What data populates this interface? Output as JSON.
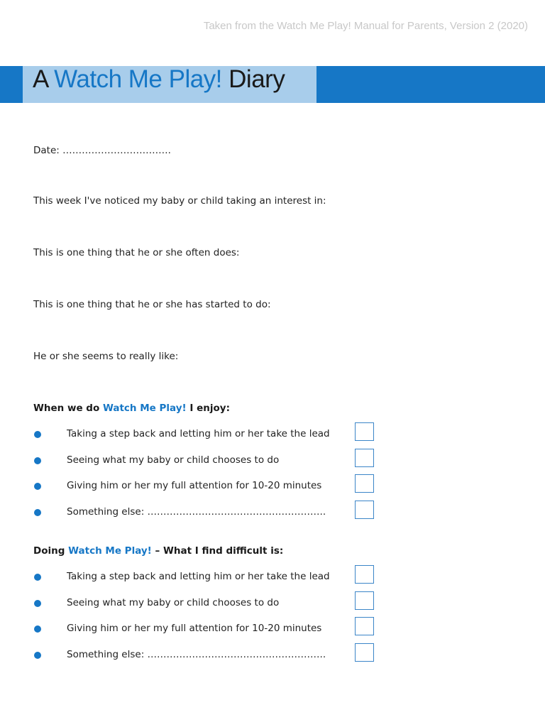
{
  "source_note": "Taken from the Watch Me Play! Manual for Parents, Version 2 (2020)",
  "title": {
    "prefix": "A ",
    "highlight": "Watch Me Play!",
    "suffix": " Diary"
  },
  "date_label": "Date: …………………………….",
  "prompts": [
    "This week I've noticed my baby or child taking an interest in:",
    "This is one thing that he or she often does:",
    "This is one thing that he or she has started to do:",
    "He or she seems to really like:"
  ],
  "sections": [
    {
      "heading_pre": "When we do ",
      "heading_highlight": "Watch Me Play!",
      "heading_post": " I enjoy:",
      "items": [
        "Taking a step back and letting him or her take the lead",
        "Seeing what my baby or child chooses to do",
        "Giving him or her my full attention for 10-20 minutes",
        "Something else: ……………………………………………….."
      ]
    },
    {
      "heading_pre": "Doing ",
      "heading_highlight": "Watch Me Play!",
      "heading_post": " – What I find difficult is:",
      "items": [
        "Taking a step back and letting him or her take the lead",
        "Seeing what my baby or child chooses to do",
        "Giving him or her my full attention for 10-20 minutes",
        "Something else: ……………………………………………….."
      ]
    }
  ],
  "colors": {
    "accent": "#1677c6",
    "light_accent": "#a8cdeb"
  }
}
